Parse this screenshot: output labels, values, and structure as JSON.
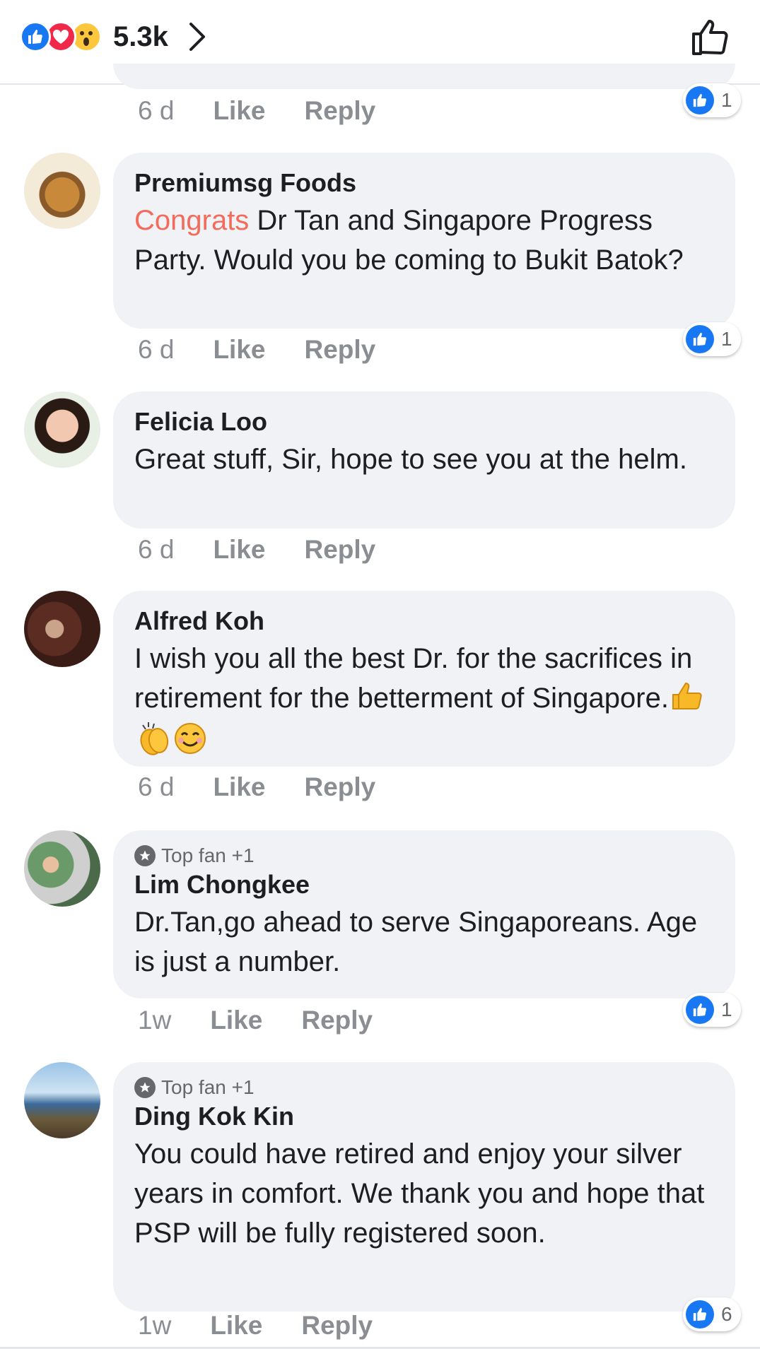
{
  "header": {
    "reaction_icons": [
      "like-icon",
      "love-icon",
      "wow-icon"
    ],
    "reaction_count": "5.3k"
  },
  "colors": {
    "facebook_blue": "#1877f2",
    "bubble_bg": "#f0f2f5",
    "meta_text": "#8a8d91",
    "mention": "#f26b5b"
  },
  "top_partial": {
    "time": "6 d",
    "like": "Like",
    "reply": "Reply",
    "reactions": "1"
  },
  "comments": [
    {
      "author": "Premiumsg Foods",
      "mention": "Congrats",
      "text": " Dr Tan and Singapore Progress Party. Would you be coming to Bukit Batok?",
      "time": "6 d",
      "like": "Like",
      "reply": "Reply",
      "reactions": "1"
    },
    {
      "author": "Felicia Loo",
      "text": "Great stuff, Sir, hope to see you at the helm.",
      "time": "6 d",
      "like": "Like",
      "reply": "Reply"
    },
    {
      "author": "Alfred Koh",
      "text": "I wish you all the best Dr. for the sacrifices in retirement for the betterment of Singapore.",
      "time": "6 d",
      "like": "Like",
      "reply": "Reply"
    },
    {
      "badge": "Top fan +1",
      "author": "Lim Chongkee",
      "text": "Dr.Tan,go ahead to serve Singaporeans. Age is just a number.",
      "time": "1w",
      "like": "Like",
      "reply": "Reply",
      "reactions": "1"
    },
    {
      "badge": "Top fan +1",
      "author": "Ding Kok Kin",
      "text": "You could have retired and enjoy your silver years in comfort. We thank you and hope that PSP will be fully registered soon.",
      "time": "1w",
      "like": "Like",
      "reply": "Reply",
      "reactions": "6"
    }
  ]
}
